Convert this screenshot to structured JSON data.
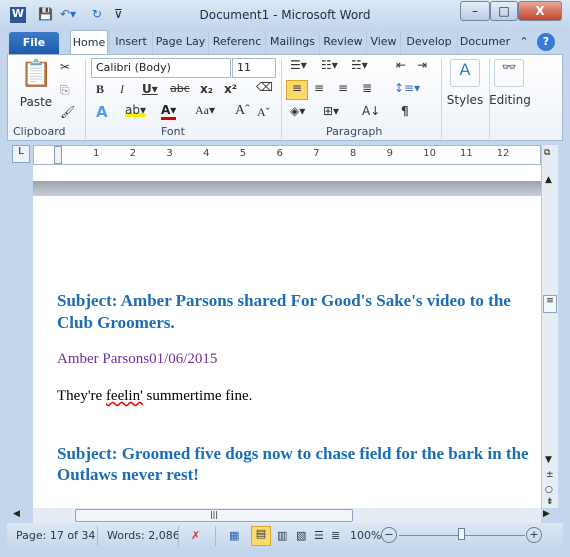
{
  "window": {
    "title": "Document1  -  Microsoft Word"
  },
  "tabs": [
    "File",
    "Home",
    "Insert",
    "Page Lay",
    "Referenc",
    "Mailings",
    "Review",
    "View",
    "Develop",
    "Documer"
  ],
  "ribbon": {
    "clipboard": {
      "paste": "Paste",
      "label": "Clipboard"
    },
    "font": {
      "name": "Calibri (Body)",
      "size": "11",
      "label": "Font"
    },
    "paragraph": {
      "label": "Paragraph"
    },
    "styles": "Styles",
    "editing": "Editing"
  },
  "ruler": [
    "1",
    "2",
    "3",
    "4",
    "5",
    "6",
    "7",
    "8",
    "9",
    "10",
    "11",
    "12"
  ],
  "document": {
    "p1": "Subject: Amber Parsons shared For Good's Sake's video to the",
    "p1b": "Club Groomers.",
    "author": "Amber Parsons01/06/2015",
    "body_pre": "They're ",
    "body_err": "feelin'",
    "body_post": " summertime  fine.",
    "p2": "Subject: Groomed five dogs now to chase field for the bark in the",
    "p2b": "Outlaws never rest!"
  },
  "colors": {
    "heading": "#1b6db5",
    "author": "#7030a0"
  },
  "status": {
    "page": "Page: 17 of 34",
    "words": "Words: 2,086",
    "zoom": "100%",
    "zoom_value": 100
  }
}
